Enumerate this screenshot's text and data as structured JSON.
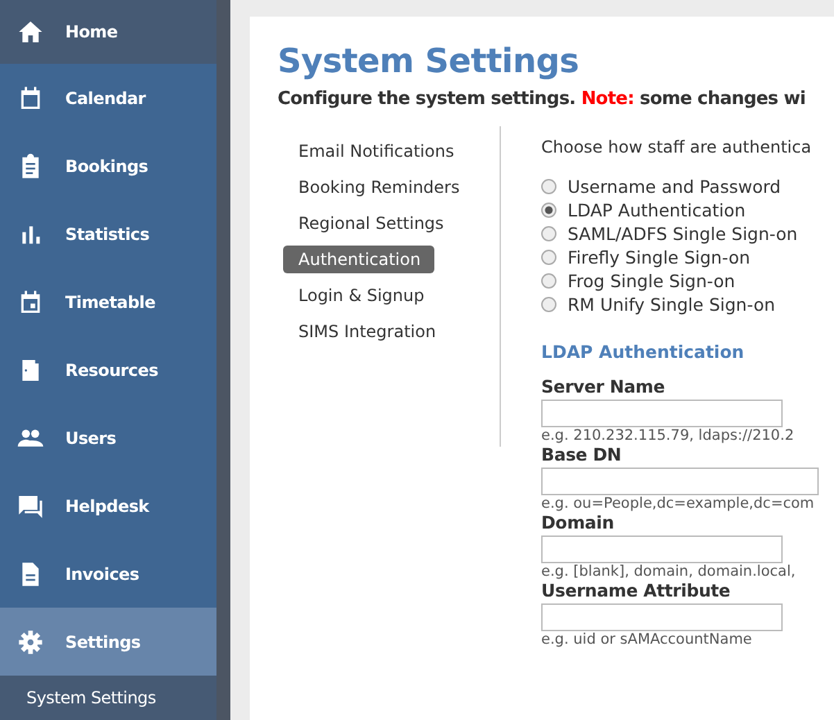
{
  "sidebar": {
    "items": [
      {
        "label": "Home",
        "selected": false,
        "kind": "top"
      },
      {
        "label": "Calendar",
        "selected": false,
        "kind": "main"
      },
      {
        "label": "Bookings",
        "selected": false,
        "kind": "main"
      },
      {
        "label": "Statistics",
        "selected": false,
        "kind": "main"
      },
      {
        "label": "Timetable",
        "selected": false,
        "kind": "main"
      },
      {
        "label": "Resources",
        "selected": false,
        "kind": "main"
      },
      {
        "label": "Users",
        "selected": false,
        "kind": "main"
      },
      {
        "label": "Helpdesk",
        "selected": false,
        "kind": "main"
      },
      {
        "label": "Invoices",
        "selected": false,
        "kind": "main"
      },
      {
        "label": "Settings",
        "selected": true,
        "kind": "main"
      },
      {
        "label": "System Settings",
        "kind": "sub"
      }
    ]
  },
  "page": {
    "title": "System Settings",
    "subtitle": "Configure the system settings.",
    "note_label": "Note:",
    "note_text": "some changes wi"
  },
  "settings_nav": [
    {
      "label": "Email Notifications",
      "selected": false
    },
    {
      "label": "Booking Reminders",
      "selected": false
    },
    {
      "label": "Regional Settings",
      "selected": false
    },
    {
      "label": "Authentication",
      "selected": true
    },
    {
      "label": "Login & Signup",
      "selected": false
    },
    {
      "label": "SIMS Integration",
      "selected": false
    }
  ],
  "auth": {
    "prompt": "Choose how staff are authentica",
    "options": [
      {
        "label": "Username and Password",
        "selected": false
      },
      {
        "label": "LDAP Authentication",
        "selected": true
      },
      {
        "label": "SAML/ADFS Single Sign-on",
        "selected": false
      },
      {
        "label": "Firefly Single Sign-on",
        "selected": false
      },
      {
        "label": "Frog Single Sign-on",
        "selected": false
      },
      {
        "label": "RM Unify Single Sign-on",
        "selected": false
      }
    ],
    "section_title": "LDAP Authentication",
    "fields": [
      {
        "label": "Server Name",
        "hint": "e.g. 210.232.115.79, ldaps://210.2"
      },
      {
        "label": "Base DN",
        "hint": "e.g. ou=People,dc=example,dc=com"
      },
      {
        "label": "Domain",
        "hint": "e.g. [blank], domain, domain.local,"
      },
      {
        "label": "Username Attribute",
        "hint": "e.g. uid or sAMAccountName"
      }
    ]
  }
}
